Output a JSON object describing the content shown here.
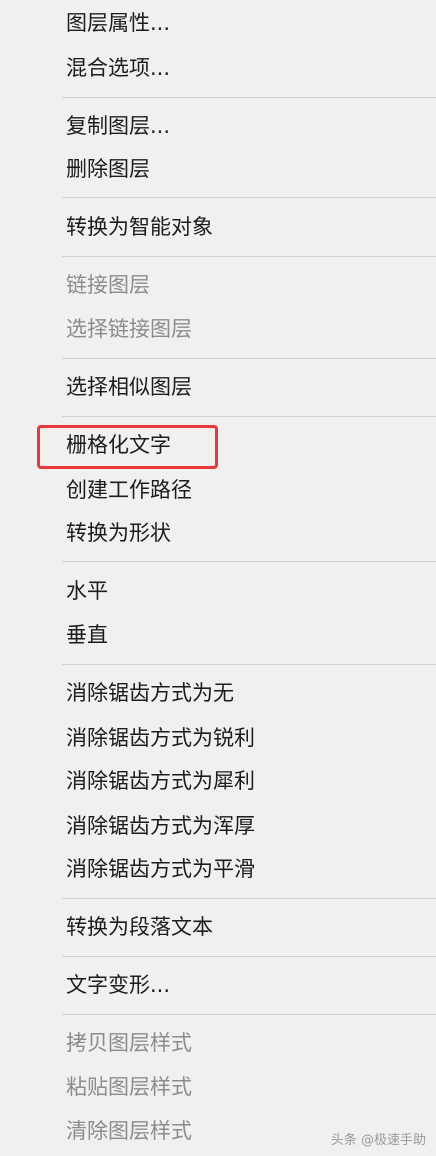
{
  "context_menu": {
    "items": [
      {
        "label": "图层属性...",
        "enabled": true
      },
      {
        "label": "混合选项...",
        "enabled": true
      },
      {
        "label": "复制图层...",
        "enabled": true
      },
      {
        "label": "删除图层",
        "enabled": true
      },
      {
        "label": "转换为智能对象",
        "enabled": true
      },
      {
        "label": "链接图层",
        "enabled": false
      },
      {
        "label": "选择链接图层",
        "enabled": false
      },
      {
        "label": "选择相似图层",
        "enabled": true
      },
      {
        "label": "栅格化文字",
        "enabled": true,
        "highlighted": true
      },
      {
        "label": "创建工作路径",
        "enabled": true
      },
      {
        "label": "转换为形状",
        "enabled": true
      },
      {
        "label": "水平",
        "enabled": true
      },
      {
        "label": "垂直",
        "enabled": true
      },
      {
        "label": "消除锯齿方式为无",
        "enabled": true
      },
      {
        "label": "消除锯齿方式为锐利",
        "enabled": true
      },
      {
        "label": "消除锯齿方式为犀利",
        "enabled": true
      },
      {
        "label": "消除锯齿方式为浑厚",
        "enabled": true
      },
      {
        "label": "消除锯齿方式为平滑",
        "enabled": true
      },
      {
        "label": "转换为段落文本",
        "enabled": true
      },
      {
        "label": "文字变形...",
        "enabled": true
      },
      {
        "label": "拷贝图层样式",
        "enabled": false
      },
      {
        "label": "粘贴图层样式",
        "enabled": false
      },
      {
        "label": "清除图层样式",
        "enabled": false
      }
    ]
  },
  "highlight_color": "#e9383a",
  "watermark": "头条 @极速手助"
}
